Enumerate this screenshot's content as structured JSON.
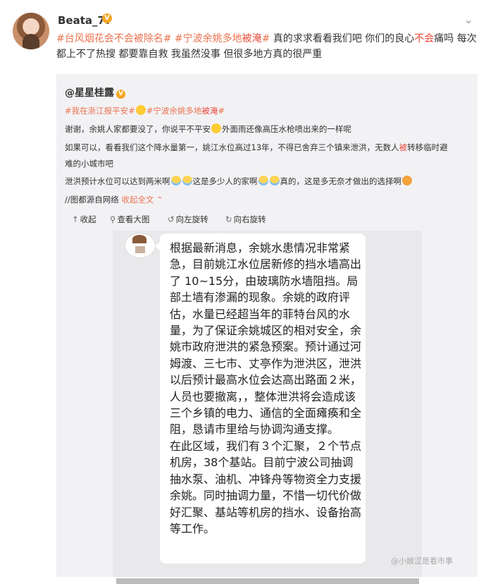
{
  "post": {
    "username": "Beata_77",
    "vip_badge": "V",
    "segments": [
      {
        "t": "#台风烟花会不会被除名#",
        "c": "tag"
      },
      {
        "t": " "
      },
      {
        "t": "#宁波余姚多地",
        "c": "tag"
      },
      {
        "t": "被淹",
        "c": "red"
      },
      {
        "t": "#",
        "c": "tag"
      },
      {
        "t": " 真的求求看看我们吧 你们的良心"
      },
      {
        "t": "不会",
        "c": "red"
      },
      {
        "t": "痛吗 每次都上不了热搜 都要靠自救 我虽然没事 但很多地方真的很严重"
      }
    ]
  },
  "quote": {
    "username": "@星星桂露",
    "vip_badge": "V",
    "line1": [
      {
        "t": "#我在浙江报平安#",
        "c": "tag"
      },
      {
        "t": "E"
      },
      {
        "t": "#宁波余姚多地",
        "c": "tag"
      },
      {
        "t": "被淹",
        "c": "red"
      },
      {
        "t": "#",
        "c": "tag"
      }
    ],
    "line2": [
      {
        "t": "谢谢，余姚人家都要没了，你说平不平安"
      },
      {
        "t": "E"
      },
      {
        "t": "外面雨还像高压水枪喷出来的一样呢"
      }
    ],
    "line3": [
      {
        "t": "如果可以，看看我们这个降水量第一，姚江水位高过13年，不得已舍弃三个镇来泄洪，无数人"
      },
      {
        "t": "被",
        "c": "red"
      },
      {
        "t": "转移临时避"
      }
    ],
    "line4": "难的小城市吧",
    "line5": [
      {
        "t": "泄洪预计水位可以达到两米啊"
      },
      {
        "t": "C"
      },
      {
        "t": "C"
      },
      {
        "t": "这是多少人的家啊"
      },
      {
        "t": "C"
      },
      {
        "t": "C"
      },
      {
        "t": "真的，这是多无奈才做出的选择啊"
      },
      {
        "t": "W"
      }
    ],
    "source_line": "//图都源自网络 收起全文",
    "source_prefix": "//图都源自网络 ",
    "expand_label": "收起全文 ⌃",
    "toolbar": {
      "collapse": "收起",
      "view_large": "查看大图",
      "rotate_left": "向左旋转",
      "rotate_right": "向右旋转"
    },
    "image_text": "根据最新消息，余姚水患情况非常紧急，目前姚江水位居新修的挡水墙高出了 10~15分，由玻璃防水墙阻挡。局部土墙有渗漏的现象。余姚的政府评估，水量已经超当年的菲特台风的水量，为了保证余姚城区的相对安全，余姚市政府泄洪的紧急预案。预计通过河姆渡、三七市、丈亭作为泄洪区，泄洪以后预计最高水位会达高出路面２米，人员也要撤离，，整体泄洪将会造成该三个乡镇的电力、通信的全面瘫痪和全阻，恳请市里给与协调沟通支撑。\n在此区域，我们有３个汇聚，２个节点机房，38个基站。目前宁波公司抽调抽水泵、油机、冲锋舟等物资全力支援余姚。同时抽调力量，不惜一切代价做好汇聚、基站等机房的挡水、设备抬高等工作。",
    "watermark": "@小娘涩是看市事"
  },
  "colors": {
    "tag": "#eb7350",
    "red": "#e94b3b",
    "quote_bg": "#f2f2f5"
  }
}
